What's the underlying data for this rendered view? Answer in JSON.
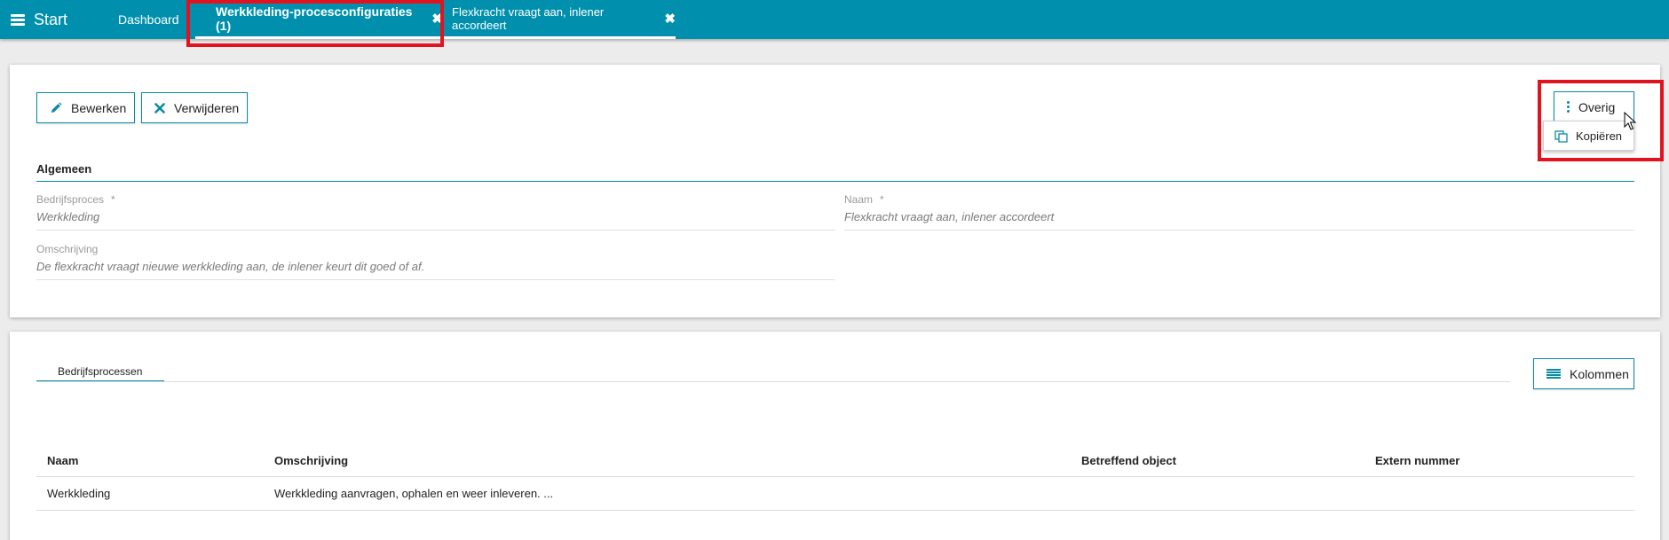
{
  "topbar": {
    "start_label": "Start",
    "tabs": [
      {
        "label": "Dashboard"
      },
      {
        "label": "Werkkleding-procesconfiguraties (1)",
        "close": "✖"
      },
      {
        "label": "Flexkracht vraagt aan, inlener accordeert",
        "close": "✖"
      }
    ]
  },
  "toolbar": {
    "edit_label": "Bewerken",
    "delete_label": "Verwijderen",
    "more_label": "Overig",
    "copy_label": "Kopiëren"
  },
  "general": {
    "section_title": "Algemeen",
    "fields": {
      "bedrijfsproces": {
        "label": "Bedrijfsproces",
        "required": "*",
        "value": "Werkkleding"
      },
      "naam": {
        "label": "Naam",
        "required": "*",
        "value": "Flexkracht vraagt aan, inlener accordeert"
      },
      "omschrijving": {
        "label": "Omschrijving",
        "value": "De flexkracht vraagt nieuwe werkkleding aan, de inlener keurt dit goed of af."
      }
    }
  },
  "list": {
    "tab_label": "Bedrijfsprocessen",
    "columns_button": "Kolommen",
    "headers": [
      "Naam",
      "Omschrijving",
      "Betreffend object",
      "Extern nummer"
    ],
    "rows": [
      {
        "naam": "Werkkleding",
        "omschrijving": "Werkkleding aanvragen, ophalen en weer inleveren. ...",
        "object": "",
        "extern": ""
      }
    ]
  },
  "colors": {
    "brand": "#0090ad",
    "accent": "#0a8aa6",
    "highlight": "#e0131f"
  }
}
